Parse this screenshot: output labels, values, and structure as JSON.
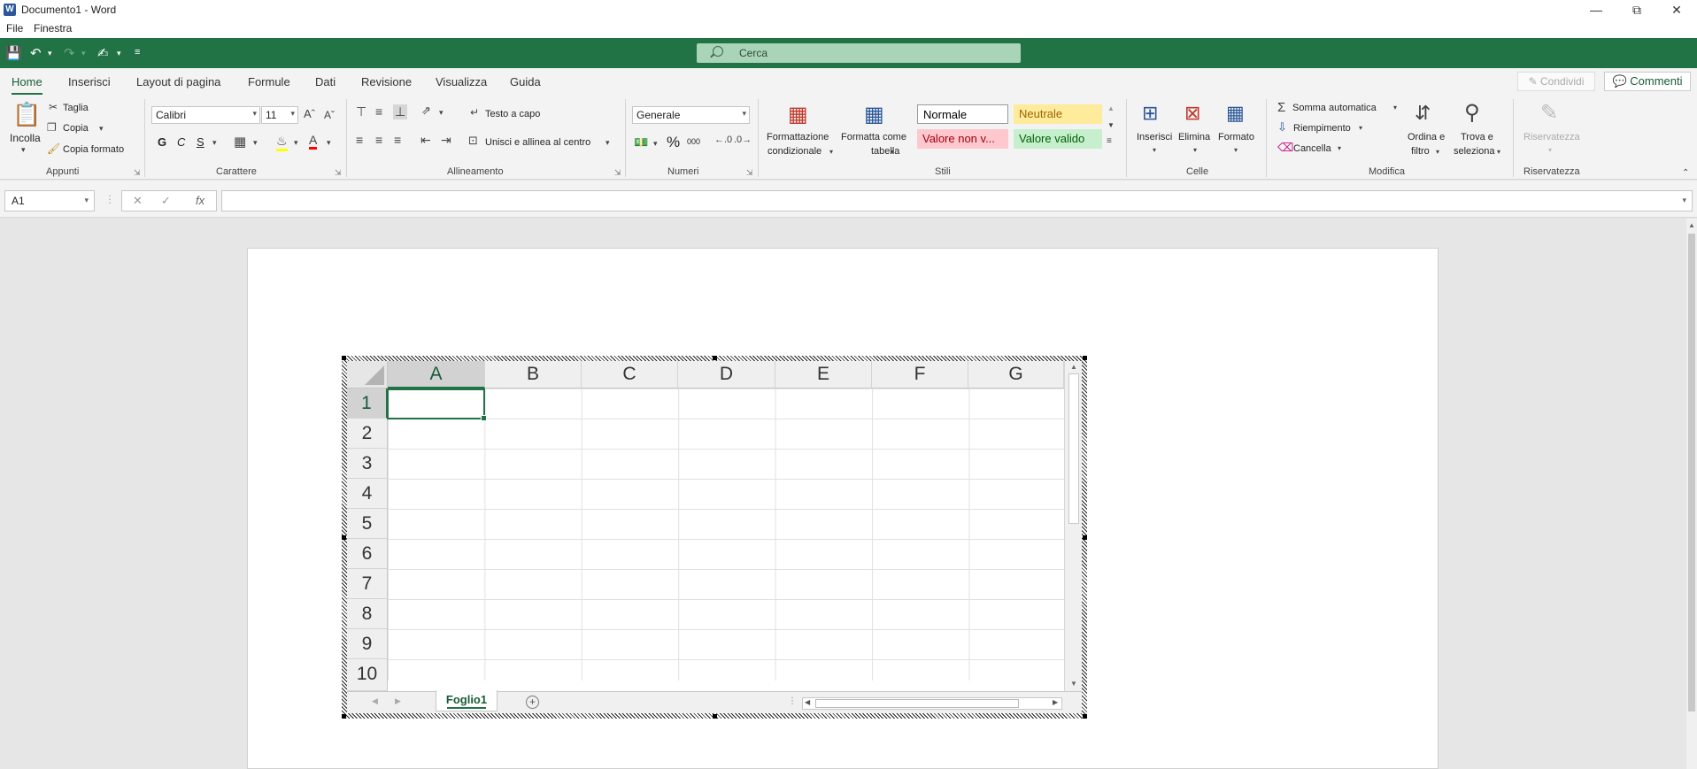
{
  "window": {
    "title": "Documento1 - Word",
    "app_icon": "W"
  },
  "menubar": {
    "file": "File",
    "window": "Finestra"
  },
  "search": {
    "placeholder": "Cerca"
  },
  "tabs": [
    "Home",
    "Inserisci",
    "Layout di pagina",
    "Formule",
    "Dati",
    "Revisione",
    "Visualizza",
    "Guida"
  ],
  "header_buttons": {
    "share": "Condividi",
    "comments": "Commenti"
  },
  "ribbon": {
    "appunti": {
      "label": "Appunti",
      "paste": "Incolla",
      "cut": "Taglia",
      "copy": "Copia",
      "format_painter": "Copia formato"
    },
    "carattere": {
      "label": "Carattere",
      "font": "Calibri",
      "size": "11",
      "bold": "G",
      "italic": "C",
      "underline": "S"
    },
    "allineamento": {
      "label": "Allineamento",
      "wrap": "Testo a capo",
      "merge": "Unisci e allinea al centro"
    },
    "numeri": {
      "label": "Numeri",
      "format": "Generale",
      "percent": "%",
      "thousands": "000"
    },
    "stili": {
      "label": "Stili",
      "conditional_1": "Formattazione",
      "conditional_2": "condizionale",
      "table_1": "Formatta come",
      "table_2": "tabella",
      "normal": "Normale",
      "neutral": "Neutrale",
      "bad": "Valore non v...",
      "good": "Valore valido"
    },
    "celle": {
      "label": "Celle",
      "insert": "Inserisci",
      "delete": "Elimina",
      "format": "Formato"
    },
    "modifica": {
      "label": "Modifica",
      "autosum": "Somma automatica",
      "fill": "Riempimento",
      "clear": "Cancella",
      "sort_1": "Ordina e",
      "sort_2": "filtro",
      "find_1": "Trova e",
      "find_2": "seleziona"
    },
    "riservatezza": {
      "label": "Riservatezza",
      "button": "Riservatezza"
    }
  },
  "formula_bar": {
    "name_box": "A1",
    "cancel": "✕",
    "enter": "✓",
    "fx": "fx",
    "value": ""
  },
  "sheet": {
    "columns": [
      "A",
      "B",
      "C",
      "D",
      "E",
      "F",
      "G"
    ],
    "rows": [
      "1",
      "2",
      "3",
      "4",
      "5",
      "6",
      "7",
      "8",
      "9",
      "10"
    ],
    "active_cell": "A1",
    "tab_name": "Foglio1",
    "add_sheet": "+"
  },
  "colors": {
    "accent": "#217346",
    "word_blue": "#2b579a",
    "neutral_bg": "#ffeb9c",
    "neutral_fg": "#9c6500",
    "bad_bg": "#ffc7ce",
    "bad_fg": "#9c0006",
    "good_bg": "#c6efce",
    "good_fg": "#006100"
  }
}
